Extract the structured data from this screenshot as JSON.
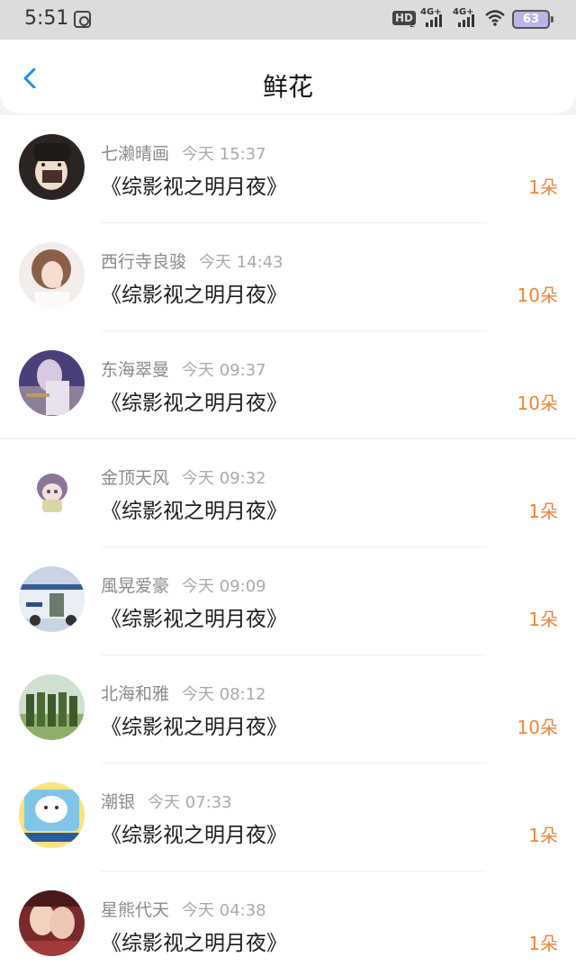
{
  "status_bar": {
    "time": "5:51",
    "hd_label": "HD",
    "hd_sub": "2",
    "signal1": "4G+",
    "signal2": "4G+",
    "battery": "63"
  },
  "header": {
    "title": "鲜花"
  },
  "entries": [
    {
      "name": "七濑晴画",
      "time": "今天 15:37",
      "book": "《综影视之明月夜》",
      "count": "1朵"
    },
    {
      "name": "西行寺良骏",
      "time": "今天 14:43",
      "book": "《综影视之明月夜》",
      "count": "10朵"
    },
    {
      "name": "东海翠曼",
      "time": "今天 09:37",
      "book": "《综影视之明月夜》",
      "count": "10朵"
    },
    {
      "name": "金顶天风",
      "time": "今天 09:32",
      "book": "《综影视之明月夜》",
      "count": "1朵"
    },
    {
      "name": "風晃爱豪",
      "time": "今天 09:09",
      "book": "《综影视之明月夜》",
      "count": "1朵"
    },
    {
      "name": "北海和雅",
      "time": "今天 08:12",
      "book": "《综影视之明月夜》",
      "count": "10朵"
    },
    {
      "name": "潮银",
      "time": "今天 07:33",
      "book": "《综影视之明月夜》",
      "count": "1朵"
    },
    {
      "name": "星熊代天",
      "time": "今天 04:38",
      "book": "《综影视之明月夜》",
      "count": "1朵"
    }
  ],
  "colors": {
    "accent": "#f0843a",
    "back": "#1e8fe6"
  }
}
